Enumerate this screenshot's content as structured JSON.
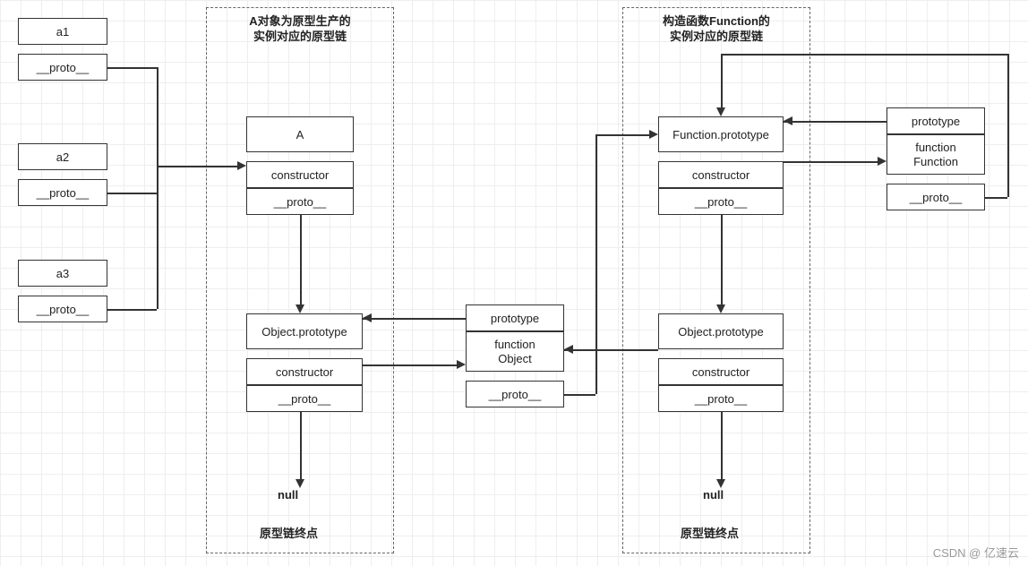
{
  "instances": {
    "a1": {
      "name": "a1",
      "proto": "__proto__"
    },
    "a2": {
      "name": "a2",
      "proto": "__proto__"
    },
    "a3": {
      "name": "a3",
      "proto": "__proto__"
    }
  },
  "leftChain": {
    "title": "A对象为原型生产的\n实例对应的原型链",
    "A": {
      "name": "A",
      "constructor": "constructor",
      "proto": "__proto__"
    },
    "ObjectProto": {
      "name": "Object.prototype",
      "constructor": "constructor",
      "proto": "__proto__"
    },
    "null": "null",
    "endpoint": "原型链终点"
  },
  "middle": {
    "Object": {
      "prototype": "prototype",
      "name": "function\nObject",
      "proto": "__proto__"
    }
  },
  "rightChain": {
    "title": "构造函数Function的\n实例对应的原型链",
    "FunctionProto": {
      "name": "Function.prototype",
      "constructor": "constructor",
      "proto": "__proto__"
    },
    "ObjectProto": {
      "name": "Object.prototype",
      "constructor": "constructor",
      "proto": "__proto__"
    },
    "null": "null",
    "endpoint": "原型链终点"
  },
  "farRight": {
    "Function": {
      "prototype": "prototype",
      "name": "function\nFunction",
      "proto": "__proto__"
    }
  },
  "watermark": "CSDN @  亿速云"
}
